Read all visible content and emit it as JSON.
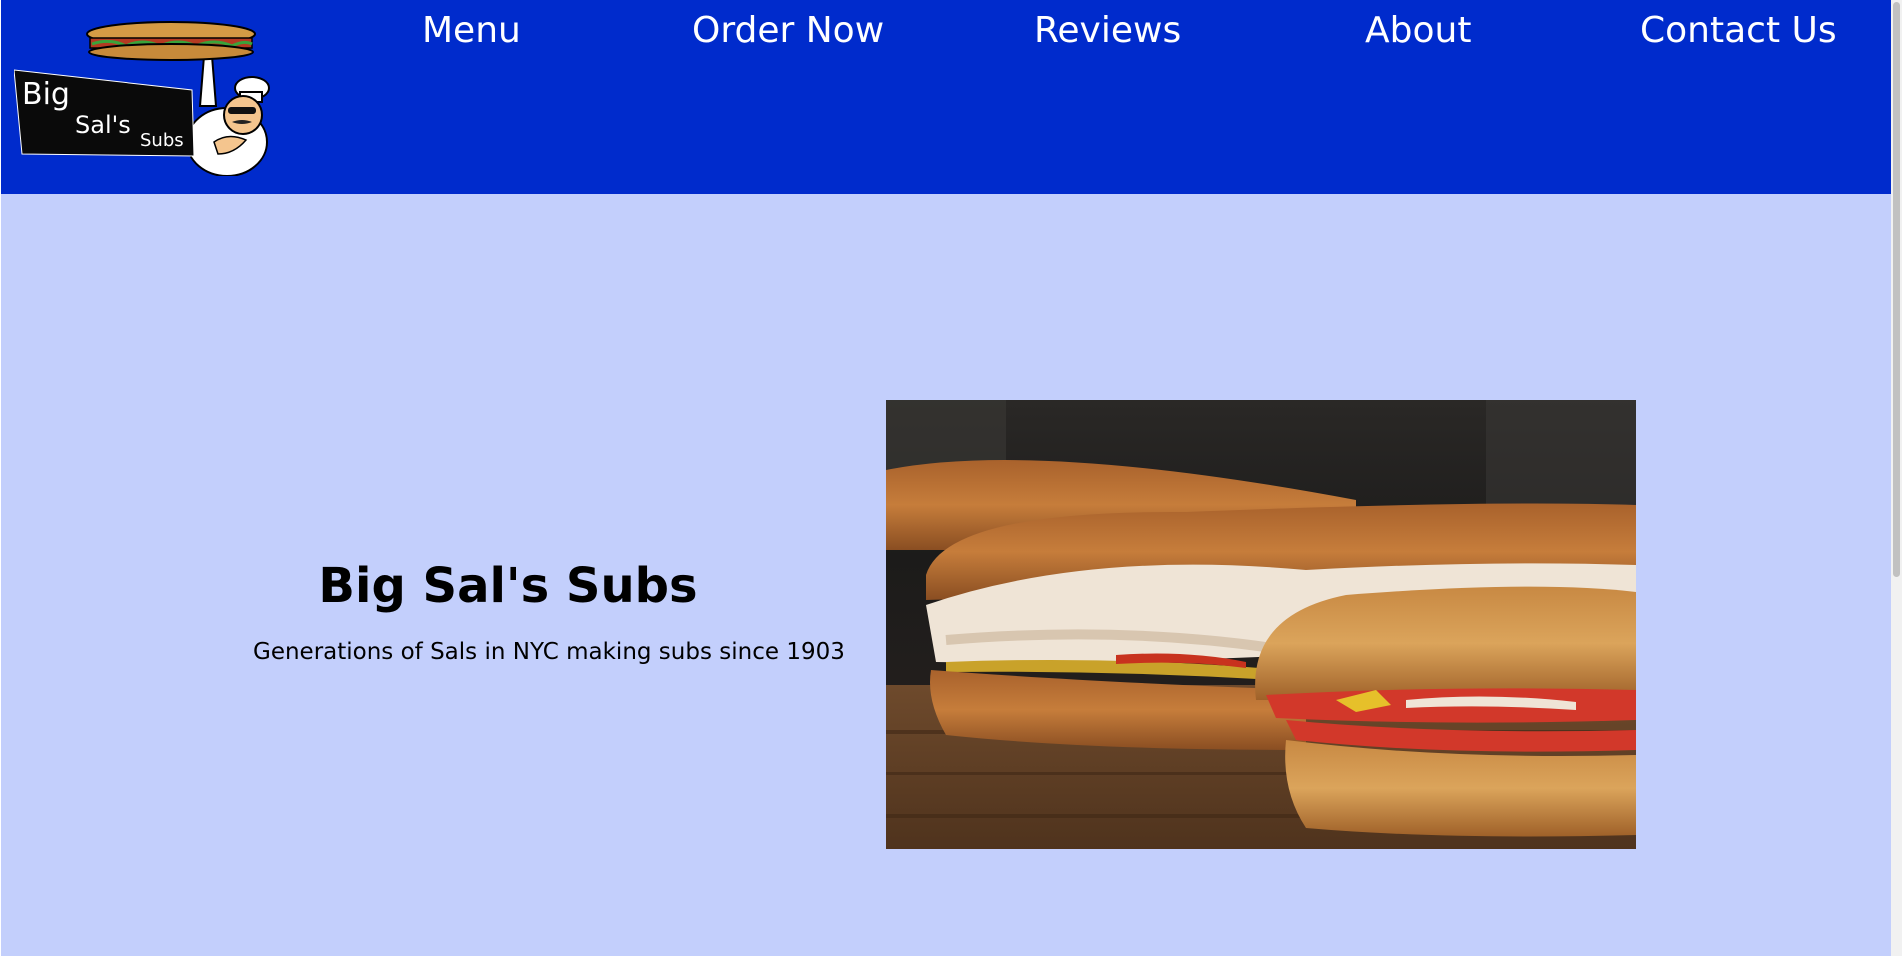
{
  "nav": {
    "items": [
      {
        "label": "Menu"
      },
      {
        "label": "Order Now"
      },
      {
        "label": "Reviews"
      },
      {
        "label": "About"
      },
      {
        "label": "Contact Us"
      }
    ]
  },
  "logo": {
    "word1": "Big",
    "word2": "Sal's",
    "word3": "Subs"
  },
  "hero": {
    "title": "Big Sal's Subs",
    "subtitle": "Generations of Sals in NYC making subs since 1903"
  },
  "colors": {
    "header_bg": "#002bcc",
    "hero_bg": "#c3cffc",
    "nav_text": "#ffffff"
  },
  "icons": {
    "logo": "chef-holding-sub-logo",
    "photo": "sub-sandwiches-photo"
  }
}
